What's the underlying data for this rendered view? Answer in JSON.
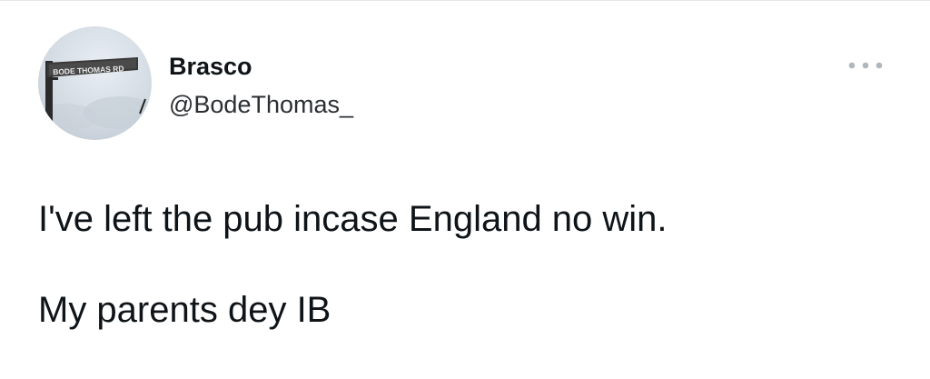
{
  "author": {
    "display_name": "Brasco",
    "handle": "@BodeThomas_",
    "avatar_sign_text": "BODE THOMAS RD"
  },
  "tweet": {
    "lines": [
      "I've left the pub incase England no win.",
      "My parents dey IB"
    ]
  },
  "icons": {
    "more": "more-options-icon"
  },
  "colors": {
    "text": "#0f1419",
    "icon": "#b0b7bd"
  }
}
